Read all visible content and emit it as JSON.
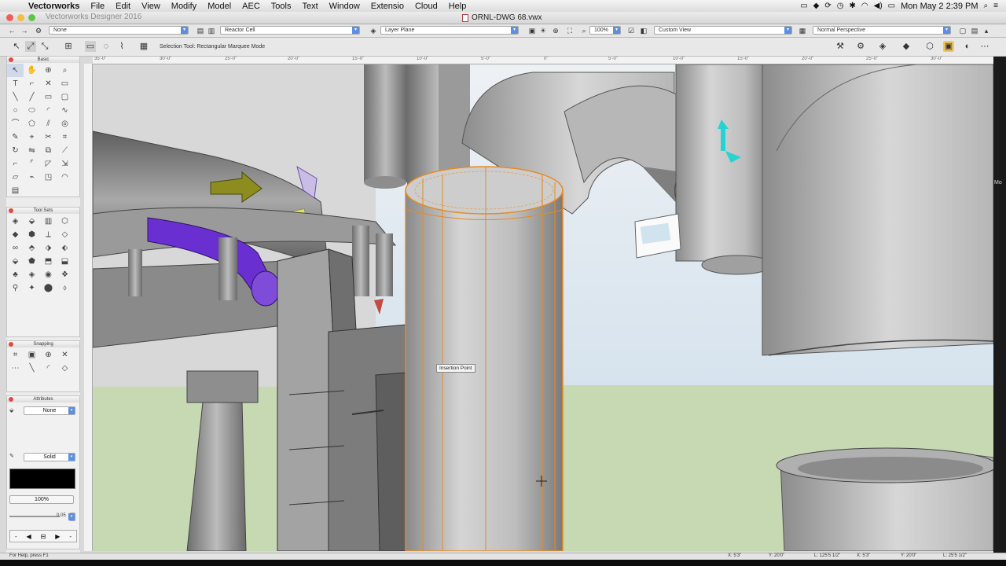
{
  "menubar": {
    "app_name": "Vectorworks",
    "items": [
      "File",
      "Edit",
      "View",
      "Modify",
      "Model",
      "AEC",
      "Tools",
      "Text",
      "Window",
      "Extensio",
      "Cloud",
      "Help"
    ],
    "clock": "Mon May 2  2:39 PM"
  },
  "window": {
    "app_title": "Vectorworks Designer 2016",
    "document_title": "ORNL-DWG 68.vwx"
  },
  "viewbar": {
    "class_value": "None",
    "layer_value": "Reactor Cell",
    "layer_plane": "Layer Plane",
    "zoom": "100%",
    "view": "Custom View",
    "projection": "Normal Perspective"
  },
  "modebar": {
    "mode_text": "Selection Tool: Rectangular Marquee Mode"
  },
  "rulers": {
    "top_labels": [
      "35'-0\"",
      "30'-0\"",
      "25'-0\"",
      "20'-0\"",
      "15'-0\"",
      "10'-0\"",
      "5'-0\"",
      "0\"",
      "5'-0\"",
      "10'-0\"",
      "15'-0\"",
      "20'-0\"",
      "25'-0\"",
      "30'-0\""
    ]
  },
  "palettes": {
    "basic_title": "Basic",
    "toolsets_title": "Tool Sets",
    "snapping_title": "Snapping",
    "attributes_title": "Attributes",
    "fill_value": "None",
    "pen_value": "Solid",
    "opacity": "100%",
    "line_weight": "0.05"
  },
  "canvas": {
    "insertion_label": "Insertion Point",
    "right_edge_text": "Mo"
  },
  "statusbar": {
    "help": "For Help, press F1",
    "x": "X: 5'3\"",
    "y": "Y: 20'0\"",
    "l": "L: 125'5 1/2\"",
    "x2": "X: 5'3\"",
    "y2": "Y: 20'0\"",
    "l2": "L: 25'5 1/2\""
  },
  "colors": {
    "selection_orange": "#e88a20",
    "sky": "#dfe8f1",
    "ground": "#c7d9b3",
    "purple_pipe": "#6a2fd0"
  }
}
